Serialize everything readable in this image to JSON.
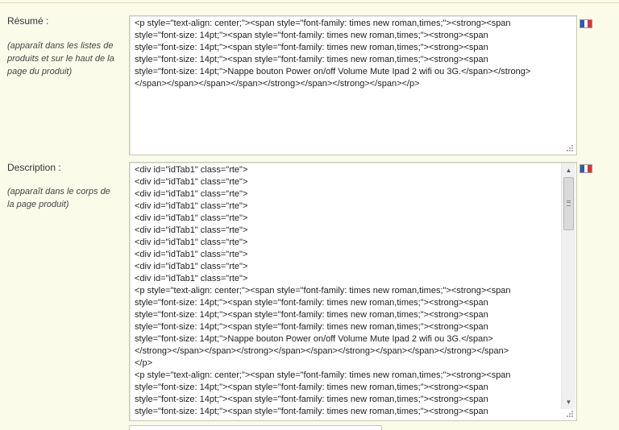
{
  "resume": {
    "label": "Résumé :",
    "hint_lines": [
      "(apparaît dans les listes de",
      "produits et sur le haut de la",
      "page du produit)"
    ],
    "lines": [
      "<p style=\"text-align: center;\"><span style=\"font-family: times new roman,times;\"><strong><span",
      "style=\"font-size: 14pt;\"><span style=\"font-family: times new roman,times;\"><strong><span",
      "style=\"font-size: 14pt;\"><span style=\"font-family: times new roman,times;\"><strong><span",
      "style=\"font-size: 14pt;\"><span style=\"font-family: times new roman,times;\"><strong><span",
      "style=\"font-size: 14pt;\">Nappe bouton Power on/off Volume Mute Ipad 2 wifi ou 3G.</span></strong>",
      "</span></span></span></span></strong></span></strong></span></p>"
    ],
    "language_flag": "flag-fr-icon"
  },
  "description": {
    "label": "Description :",
    "hint_lines": [
      "(apparaît dans le corps de",
      "la page produit)"
    ],
    "lines": [
      "<div id=\"idTab1\" class=\"rte\">",
      "<div id=\"idTab1\" class=\"rte\">",
      "<div id=\"idTab1\" class=\"rte\">",
      "<div id=\"idTab1\" class=\"rte\">",
      "<div id=\"idTab1\" class=\"rte\">",
      "<div id=\"idTab1\" class=\"rte\">",
      "<div id=\"idTab1\" class=\"rte\">",
      "<div id=\"idTab1\" class=\"rte\">",
      "<div id=\"idTab1\" class=\"rte\">",
      "<div id=\"idTab1\" class=\"rte\">",
      "<p style=\"text-align: center;\"><span style=\"font-family: times new roman,times;\"><strong><span",
      "style=\"font-size: 14pt;\"><span style=\"font-family: times new roman,times;\"><strong><span",
      "style=\"font-size: 14pt;\"><span style=\"font-family: times new roman,times;\"><strong><span",
      "style=\"font-size: 14pt;\"><span style=\"font-family: times new roman,times;\"><strong><span",
      "style=\"font-size: 14pt;\">Nappe bouton Power on/off Volume Mute Ipad 2 wifi ou 3G.</span>",
      "</strong></span></span></strong></span></span></strong></span></span></strong></span>",
      "</p>",
      "<p style=\"text-align: center;\"><span style=\"font-family: times new roman,times;\"><strong><span",
      "style=\"font-size: 14pt;\"><span style=\"font-family: times new roman,times;\"><strong><span",
      "style=\"font-size: 14pt;\"><span style=\"font-family: times new roman,times;\"><strong><span",
      "style=\"font-size: 14pt;\"><span style=\"font-family: times new roman,times;\"><strong><span"
    ],
    "language_flag": "flag-fr-icon",
    "scroll_up": "▲",
    "scroll_down": "▼"
  },
  "colors": {
    "background": "#fbfbe9",
    "flag_blue": "#2a5bb5",
    "flag_white": "#ffffff",
    "flag_red": "#d9343a"
  }
}
